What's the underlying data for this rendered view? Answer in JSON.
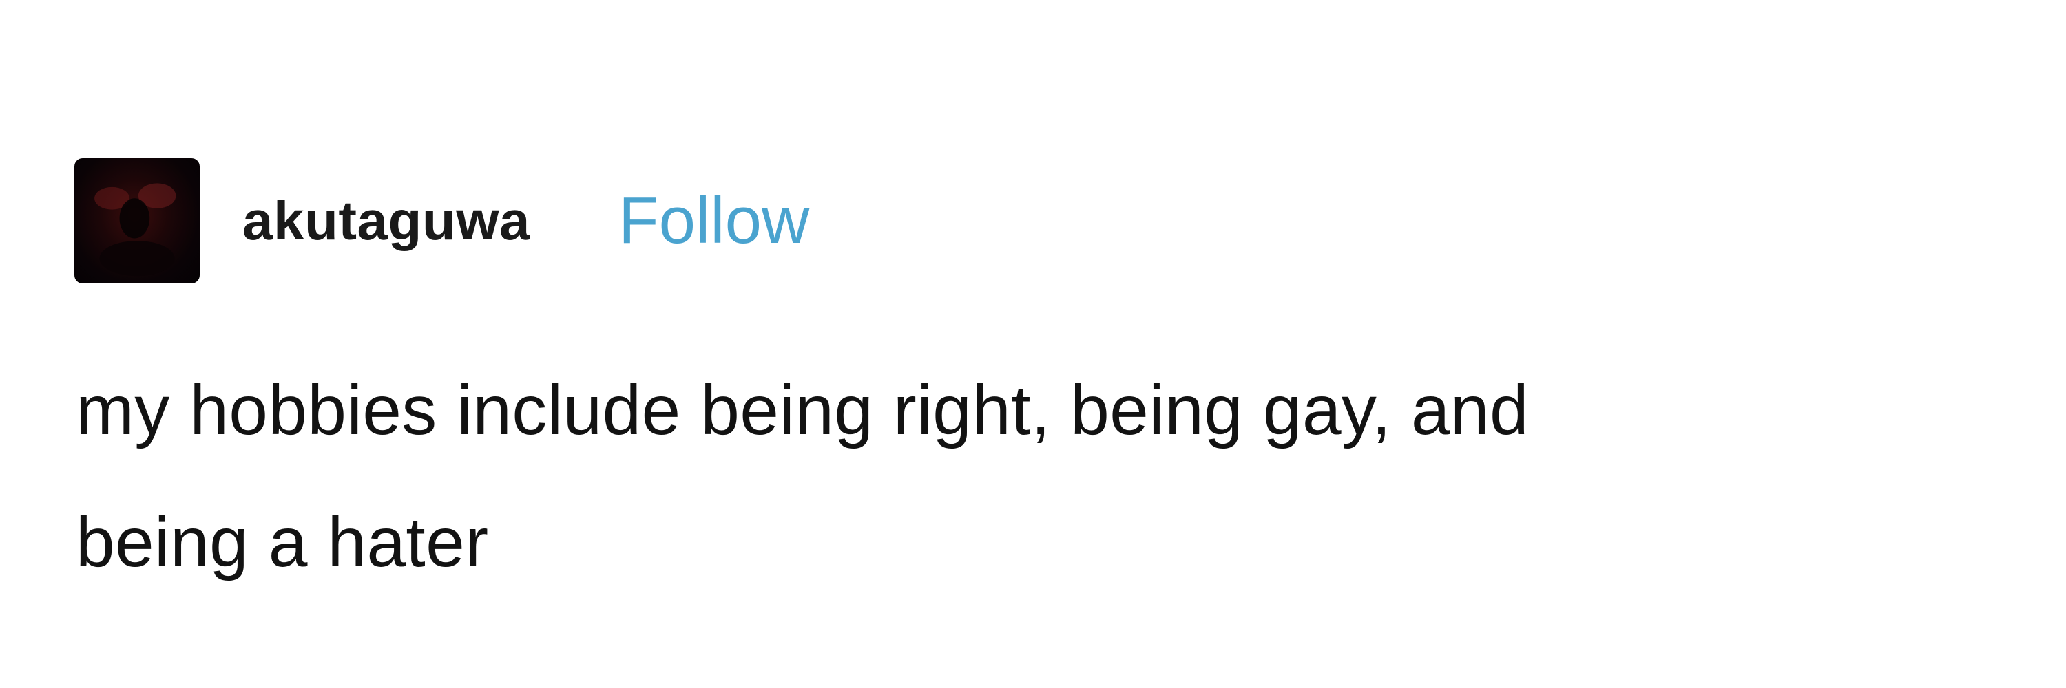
{
  "post": {
    "author": {
      "username": "akutaguwa",
      "avatar_icon": "dark-red-avatar-icon"
    },
    "follow_label": "Follow",
    "text_lines": [
      "my hobbies include being right, being gay, and",
      "being a hater"
    ]
  },
  "colors": {
    "follow": "#4aa3cf",
    "text": "#121212",
    "background": "#ffffff"
  }
}
